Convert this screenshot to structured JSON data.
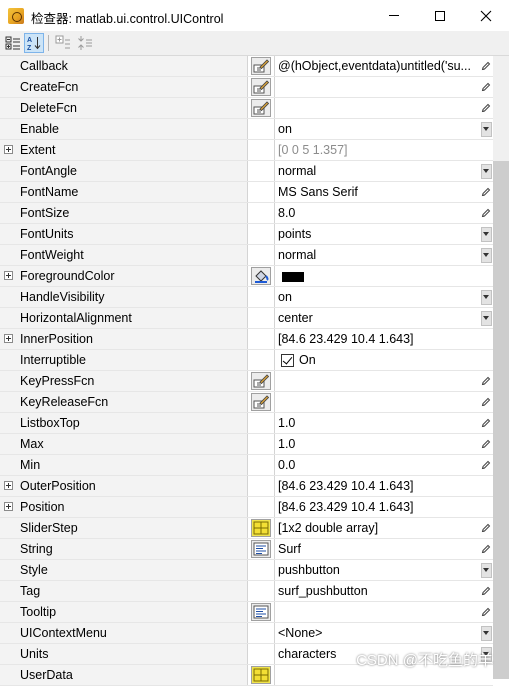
{
  "window": {
    "title": "检查器:  matlab.ui.control.UIControl"
  },
  "toolbar": {
    "buttons": [
      "categorize-icon",
      "sort-alpha-icon",
      "expand-all-icon",
      "collapse-all-icon"
    ]
  },
  "rows": [
    {
      "name": "Callback",
      "value": "@(hObject,eventdata)untitled('su...",
      "expand": false,
      "btn": "edit",
      "action": "pencil"
    },
    {
      "name": "CreateFcn",
      "value": "",
      "expand": false,
      "btn": "edit",
      "action": "pencil"
    },
    {
      "name": "DeleteFcn",
      "value": "",
      "expand": false,
      "btn": "edit",
      "action": "pencil"
    },
    {
      "name": "Enable",
      "value": "on",
      "expand": false,
      "btn": "",
      "action": "dropdown"
    },
    {
      "name": "Extent",
      "value": "[0 0 5 1.357]",
      "expand": true,
      "btn": "",
      "action": "",
      "gray": true
    },
    {
      "name": "FontAngle",
      "value": "normal",
      "expand": false,
      "btn": "",
      "action": "dropdown"
    },
    {
      "name": "FontName",
      "value": "MS Sans Serif",
      "expand": false,
      "btn": "",
      "action": "pencil"
    },
    {
      "name": "FontSize",
      "value": "8.0",
      "expand": false,
      "btn": "",
      "action": "pencil"
    },
    {
      "name": "FontUnits",
      "value": "points",
      "expand": false,
      "btn": "",
      "action": "dropdown"
    },
    {
      "name": "FontWeight",
      "value": "normal",
      "expand": false,
      "btn": "",
      "action": "dropdown"
    },
    {
      "name": "ForegroundColor",
      "value": "",
      "expand": true,
      "btn": "paint",
      "action": "",
      "swatch": "#000000"
    },
    {
      "name": "HandleVisibility",
      "value": "on",
      "expand": false,
      "btn": "",
      "action": "dropdown"
    },
    {
      "name": "HorizontalAlignment",
      "value": "center",
      "expand": false,
      "btn": "",
      "action": "dropdown"
    },
    {
      "name": "InnerPosition",
      "value": "[84.6 23.429 10.4 1.643]",
      "expand": true,
      "btn": "",
      "action": ""
    },
    {
      "name": "Interruptible",
      "value": "On",
      "expand": false,
      "btn": "",
      "action": "",
      "checkbox": true
    },
    {
      "name": "KeyPressFcn",
      "value": "",
      "expand": false,
      "btn": "edit",
      "action": "pencil"
    },
    {
      "name": "KeyReleaseFcn",
      "value": "",
      "expand": false,
      "btn": "edit",
      "action": "pencil"
    },
    {
      "name": "ListboxTop",
      "value": "1.0",
      "expand": false,
      "btn": "",
      "action": "pencil"
    },
    {
      "name": "Max",
      "value": "1.0",
      "expand": false,
      "btn": "",
      "action": "pencil"
    },
    {
      "name": "Min",
      "value": "0.0",
      "expand": false,
      "btn": "",
      "action": "pencil"
    },
    {
      "name": "OuterPosition",
      "value": "[84.6 23.429 10.4 1.643]",
      "expand": true,
      "btn": "",
      "action": ""
    },
    {
      "name": "Position",
      "value": "[84.6 23.429 10.4 1.643]",
      "expand": true,
      "btn": "",
      "action": ""
    },
    {
      "name": "SliderStep",
      "value": "[1x2  double array]",
      "expand": false,
      "btn": "grid",
      "action": "pencil"
    },
    {
      "name": "String",
      "value": "Surf",
      "expand": false,
      "btn": "text",
      "action": "pencil"
    },
    {
      "name": "Style",
      "value": "pushbutton",
      "expand": false,
      "btn": "",
      "action": "dropdown"
    },
    {
      "name": "Tag",
      "value": "surf_pushbutton",
      "expand": false,
      "btn": "",
      "action": "pencil"
    },
    {
      "name": "Tooltip",
      "value": "",
      "expand": false,
      "btn": "text",
      "action": "pencil"
    },
    {
      "name": "UIContextMenu",
      "value": "<None>",
      "expand": false,
      "btn": "",
      "action": "dropdown"
    },
    {
      "name": "Units",
      "value": "characters",
      "expand": false,
      "btn": "",
      "action": "dropdown"
    },
    {
      "name": "UserData",
      "value": "",
      "expand": false,
      "btn": "grid",
      "action": ""
    }
  ],
  "watermark": "CSDN @不吃鱼的羊"
}
